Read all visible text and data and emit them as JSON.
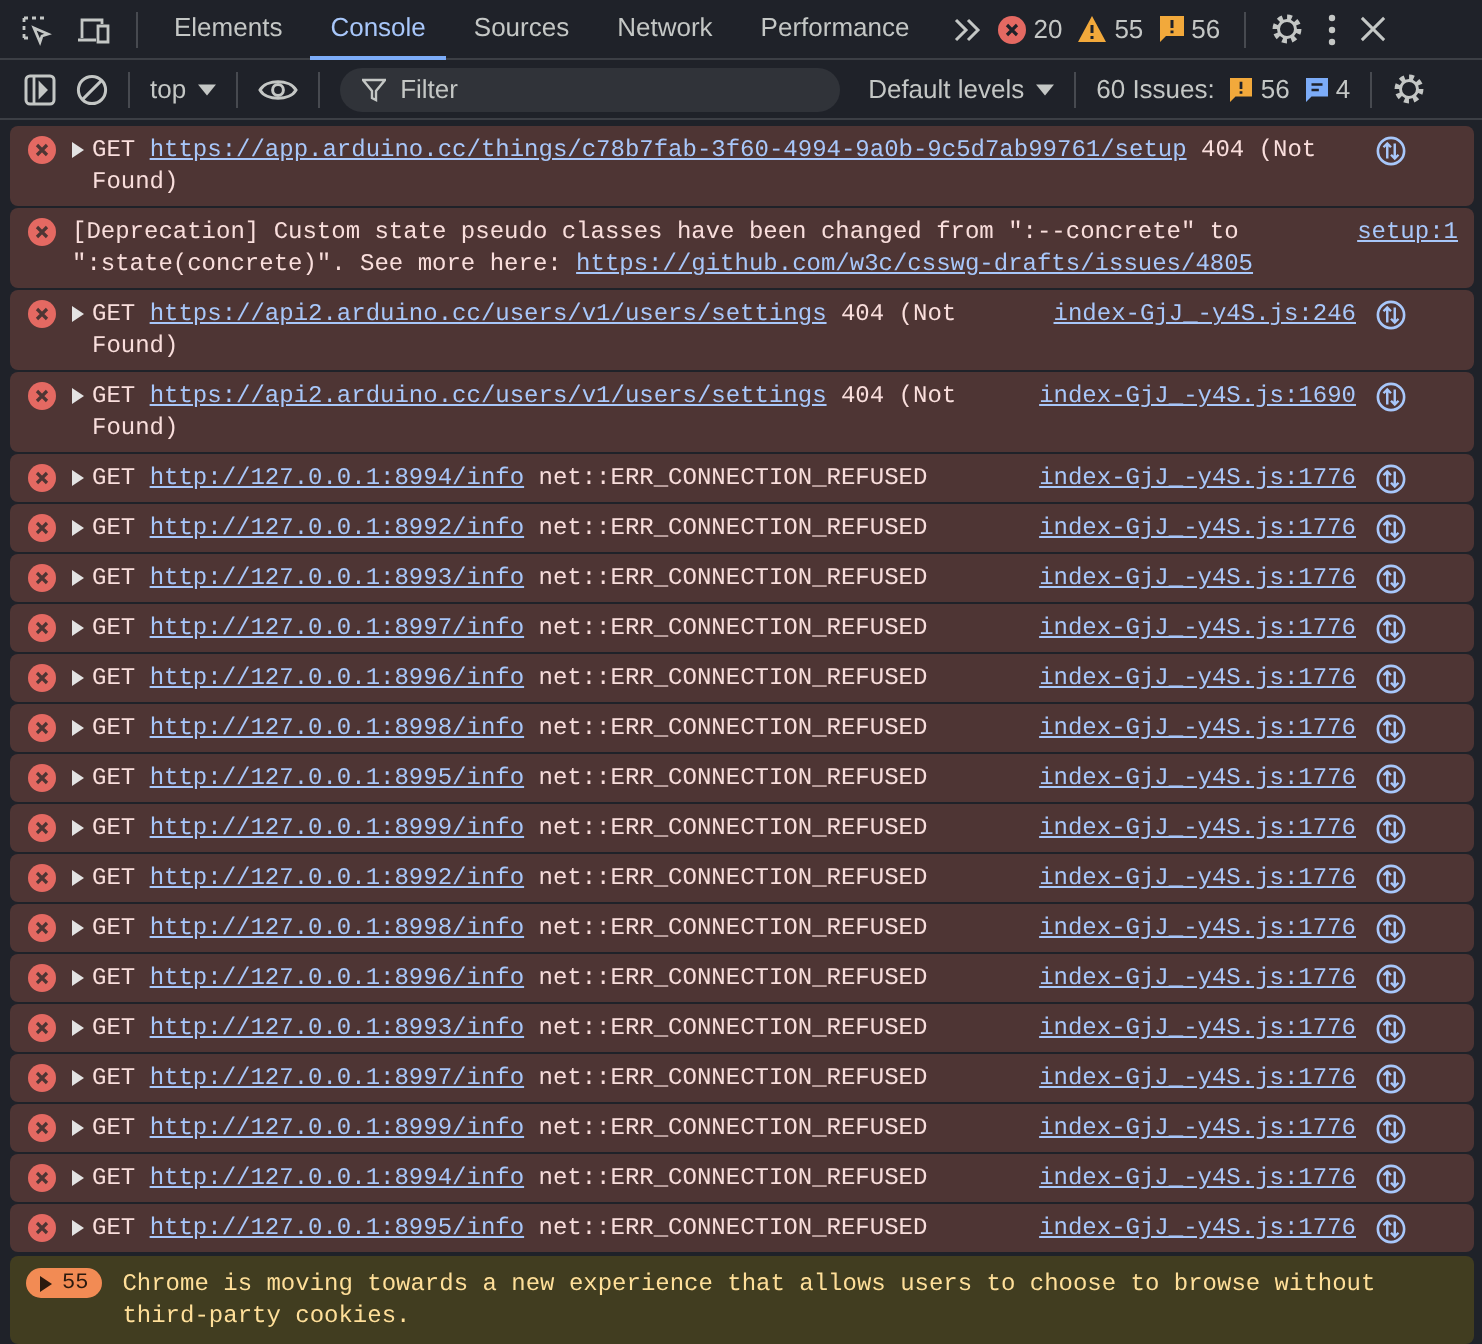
{
  "tabs": [
    {
      "label": "Elements",
      "selected": false
    },
    {
      "label": "Console",
      "selected": true
    },
    {
      "label": "Sources",
      "selected": false
    },
    {
      "label": "Network",
      "selected": false
    },
    {
      "label": "Performance",
      "selected": false
    }
  ],
  "counters": [
    {
      "kind": "error",
      "count": "20"
    },
    {
      "kind": "warning",
      "count": "55"
    },
    {
      "kind": "issue",
      "count": "56"
    }
  ],
  "filter_bar": {
    "context": "top",
    "placeholder": "Filter",
    "levels": "Default levels",
    "issues_label": "60 Issues:",
    "issue_counts": [
      {
        "kind": "issue",
        "count": "56"
      },
      {
        "kind": "info",
        "count": "4"
      }
    ]
  },
  "messages": [
    {
      "kind": "error",
      "expandable": true,
      "network": true,
      "text": "GET",
      "url": "https://app.arduino.cc/things/c78b7fab-3f60-4994-9a0b-9c5d7ab99761/setup",
      "suffix": "404 (Not Found)"
    },
    {
      "kind": "error",
      "expandable": false,
      "network": false,
      "source": "setup:1",
      "text": "[Deprecation] Custom state pseudo classes have been changed from \":--concrete\" to \":state(concrete)\". See more here:",
      "url": "https://github.com/w3c/csswg-drafts/issues/4805"
    },
    {
      "kind": "error",
      "expandable": true,
      "network": true,
      "source": "index-GjJ_-y4S.js:246",
      "text": "GET",
      "url": "https://api2.arduino.cc/users/v1/users/settings",
      "suffix": "404 (Not Found)"
    },
    {
      "kind": "error",
      "expandable": true,
      "network": true,
      "source": "index-GjJ_-y4S.js:1690",
      "text": "GET",
      "url": "https://api2.arduino.cc/users/v1/users/settings",
      "suffix": "404 (Not Found)"
    },
    {
      "kind": "error",
      "expandable": true,
      "network": true,
      "source": "index-GjJ_-y4S.js:1776",
      "text": "GET",
      "url": "http://127.0.0.1:8994/info",
      "suffix": "net::ERR_CONNECTION_REFUSED"
    },
    {
      "kind": "error",
      "expandable": true,
      "network": true,
      "source": "index-GjJ_-y4S.js:1776",
      "text": "GET",
      "url": "http://127.0.0.1:8992/info",
      "suffix": "net::ERR_CONNECTION_REFUSED"
    },
    {
      "kind": "error",
      "expandable": true,
      "network": true,
      "source": "index-GjJ_-y4S.js:1776",
      "text": "GET",
      "url": "http://127.0.0.1:8993/info",
      "suffix": "net::ERR_CONNECTION_REFUSED"
    },
    {
      "kind": "error",
      "expandable": true,
      "network": true,
      "source": "index-GjJ_-y4S.js:1776",
      "text": "GET",
      "url": "http://127.0.0.1:8997/info",
      "suffix": "net::ERR_CONNECTION_REFUSED"
    },
    {
      "kind": "error",
      "expandable": true,
      "network": true,
      "source": "index-GjJ_-y4S.js:1776",
      "text": "GET",
      "url": "http://127.0.0.1:8996/info",
      "suffix": "net::ERR_CONNECTION_REFUSED"
    },
    {
      "kind": "error",
      "expandable": true,
      "network": true,
      "source": "index-GjJ_-y4S.js:1776",
      "text": "GET",
      "url": "http://127.0.0.1:8998/info",
      "suffix": "net::ERR_CONNECTION_REFUSED"
    },
    {
      "kind": "error",
      "expandable": true,
      "network": true,
      "source": "index-GjJ_-y4S.js:1776",
      "text": "GET",
      "url": "http://127.0.0.1:8995/info",
      "suffix": "net::ERR_CONNECTION_REFUSED"
    },
    {
      "kind": "error",
      "expandable": true,
      "network": true,
      "source": "index-GjJ_-y4S.js:1776",
      "text": "GET",
      "url": "http://127.0.0.1:8999/info",
      "suffix": "net::ERR_CONNECTION_REFUSED"
    },
    {
      "kind": "error",
      "expandable": true,
      "network": true,
      "source": "index-GjJ_-y4S.js:1776",
      "text": "GET",
      "url": "http://127.0.0.1:8992/info",
      "suffix": "net::ERR_CONNECTION_REFUSED"
    },
    {
      "kind": "error",
      "expandable": true,
      "network": true,
      "source": "index-GjJ_-y4S.js:1776",
      "text": "GET",
      "url": "http://127.0.0.1:8998/info",
      "suffix": "net::ERR_CONNECTION_REFUSED"
    },
    {
      "kind": "error",
      "expandable": true,
      "network": true,
      "source": "index-GjJ_-y4S.js:1776",
      "text": "GET",
      "url": "http://127.0.0.1:8996/info",
      "suffix": "net::ERR_CONNECTION_REFUSED"
    },
    {
      "kind": "error",
      "expandable": true,
      "network": true,
      "source": "index-GjJ_-y4S.js:1776",
      "text": "GET",
      "url": "http://127.0.0.1:8993/info",
      "suffix": "net::ERR_CONNECTION_REFUSED"
    },
    {
      "kind": "error",
      "expandable": true,
      "network": true,
      "source": "index-GjJ_-y4S.js:1776",
      "text": "GET",
      "url": "http://127.0.0.1:8997/info",
      "suffix": "net::ERR_CONNECTION_REFUSED"
    },
    {
      "kind": "error",
      "expandable": true,
      "network": true,
      "source": "index-GjJ_-y4S.js:1776",
      "text": "GET",
      "url": "http://127.0.0.1:8999/info",
      "suffix": "net::ERR_CONNECTION_REFUSED"
    },
    {
      "kind": "error",
      "expandable": true,
      "network": true,
      "source": "index-GjJ_-y4S.js:1776",
      "text": "GET",
      "url": "http://127.0.0.1:8994/info",
      "suffix": "net::ERR_CONNECTION_REFUSED"
    },
    {
      "kind": "error",
      "expandable": true,
      "network": true,
      "source": "index-GjJ_-y4S.js:1776",
      "text": "GET",
      "url": "http://127.0.0.1:8995/info",
      "suffix": "net::ERR_CONNECTION_REFUSED"
    },
    {
      "kind": "warning",
      "expandable": true,
      "network": false,
      "count": "55",
      "text": "Chrome is moving towards a new experience that allows users to choose to browse without third-party cookies."
    }
  ]
}
